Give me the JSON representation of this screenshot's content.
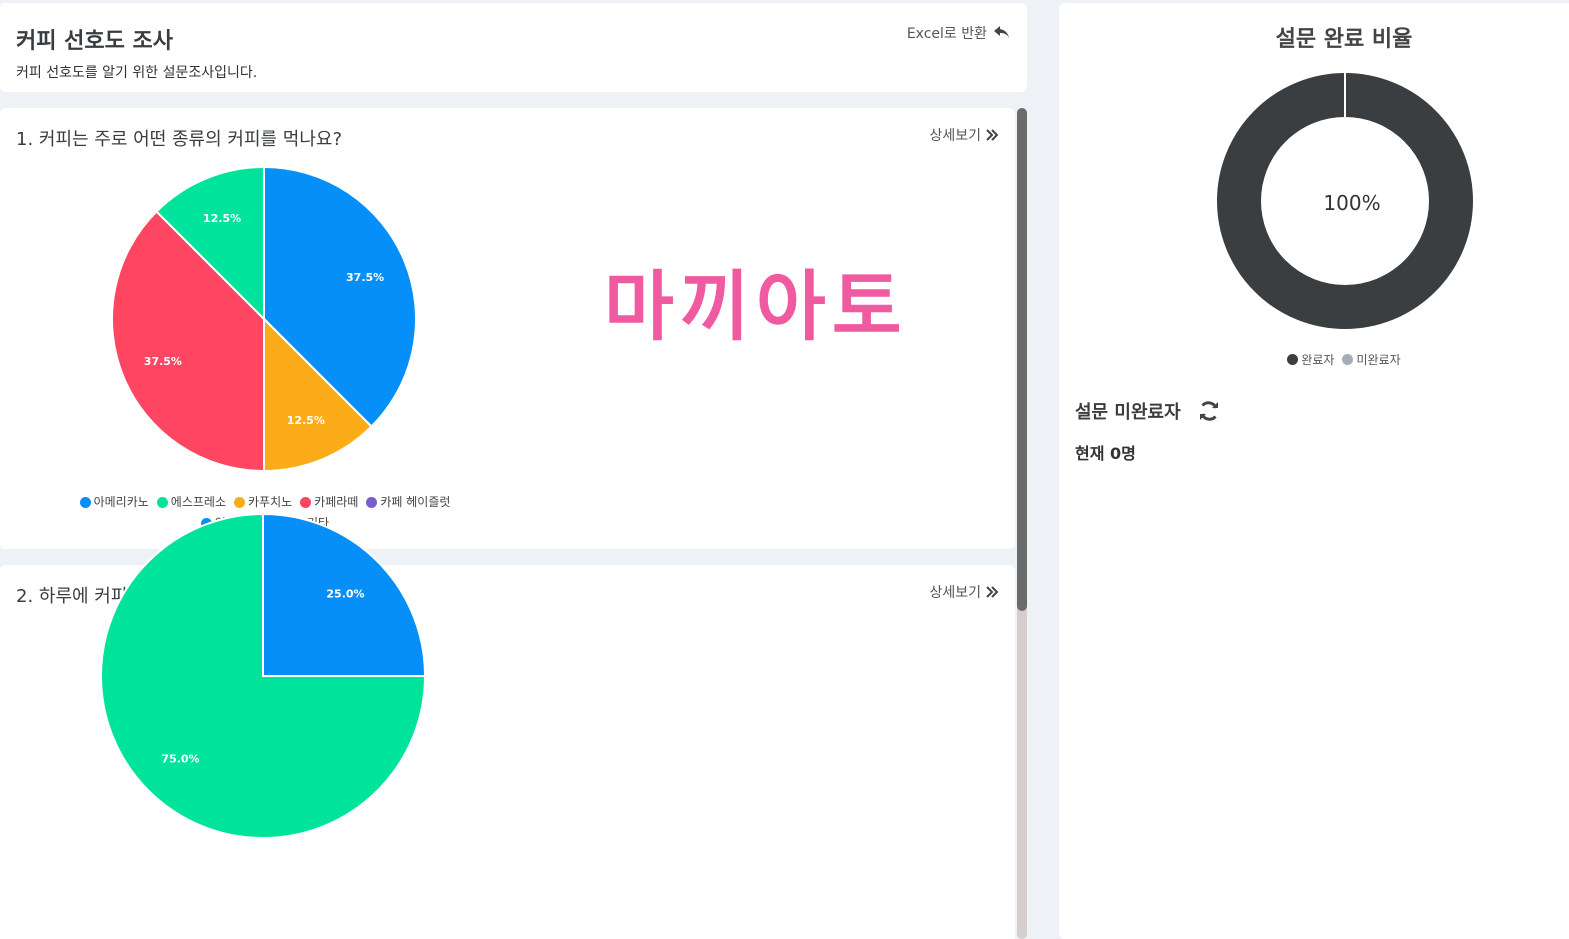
{
  "header": {
    "title": "커피 선호도 조사",
    "description": "커피 선호도를 알기 위한 설문조사입니다.",
    "excel_label": "Excel로 반환"
  },
  "questions": [
    {
      "title": "1. 커피는 주로 어떤 종류의 커피를 먹나요?",
      "detail_label": "상세보기"
    },
    {
      "title": "2. 하루에 커피를 얼마나 드시나요?",
      "detail_label": "상세보기"
    }
  ],
  "overlay_text": "마끼아토",
  "sidebar": {
    "title": "설문 완료 비율",
    "legend": [
      "완료자",
      "미완료자"
    ],
    "legend_colors": [
      "#3b3e41",
      "#a5aeb6"
    ],
    "incomplete_title": "설문 미완료자",
    "incomplete_count": "현재 0명"
  },
  "chart_data": [
    {
      "type": "pie",
      "title": "1. 커피는 주로 어떤 종류의 커피를 먹나요?",
      "categories": [
        "아메리카노",
        "에스프레소",
        "카푸치노",
        "카페라떼",
        "카페 헤이즐럿",
        "인스턴트 커피",
        "기타"
      ],
      "values": [
        37.5,
        0,
        12.5,
        37.5,
        0,
        0,
        12.5
      ],
      "labels": [
        "37.5%",
        "",
        "12.5%",
        "37.5%",
        "",
        "",
        "12.5%"
      ],
      "colors": [
        "#068ff9",
        "#00e39b",
        "#fdac19",
        "#fe4561",
        "#785dd1",
        "#068ff9",
        "#00e39b"
      ]
    },
    {
      "type": "pie",
      "title": "2. 하루에 커피를 얼마나 드시나요?",
      "categories": [
        "",
        ""
      ],
      "values": [
        25.0,
        75.0
      ],
      "labels": [
        "25.0%",
        "75.0%"
      ],
      "colors": [
        "#068ff9",
        "#00e39b"
      ]
    },
    {
      "type": "pie",
      "title": "설문 완료 비율",
      "categories": [
        "완료자",
        "미완료자"
      ],
      "values": [
        100,
        0
      ],
      "center_label": "100%",
      "colors": [
        "#3b3e41",
        "#a5aeb6"
      ]
    }
  ]
}
